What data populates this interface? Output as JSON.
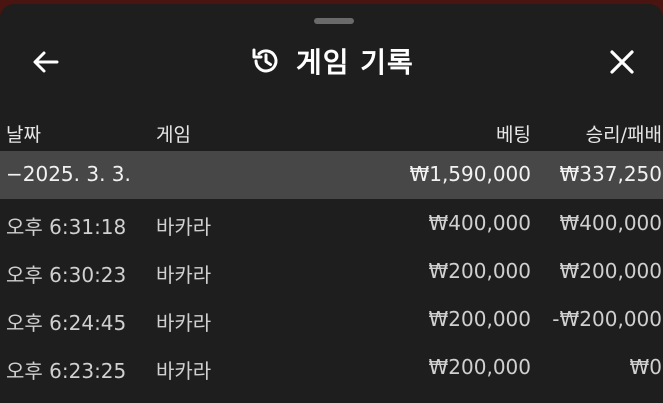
{
  "header": {
    "title": "게임 기록",
    "back_icon": "arrow-left-icon",
    "history_icon": "history-icon",
    "close_icon": "close-icon"
  },
  "columns": {
    "date": "날짜",
    "game": "게임",
    "bet": "베팅",
    "result": "승리/패배"
  },
  "summary": {
    "date": "−2025. 3. 3.",
    "game": "",
    "bet": "₩1,590,000",
    "result": "₩337,250"
  },
  "rows": [
    {
      "time": "오후 6:31:18",
      "game": "바카라",
      "bet": "₩400,000",
      "result": "₩400,000"
    },
    {
      "time": "오후 6:30:23",
      "game": "바카라",
      "bet": "₩200,000",
      "result": "₩200,000"
    },
    {
      "time": "오후 6:24:45",
      "game": "바카라",
      "bet": "₩200,000",
      "result": "-₩200,000"
    },
    {
      "time": "오후 6:23:25",
      "game": "바카라",
      "bet": "₩200,000",
      "result": "₩0"
    }
  ]
}
